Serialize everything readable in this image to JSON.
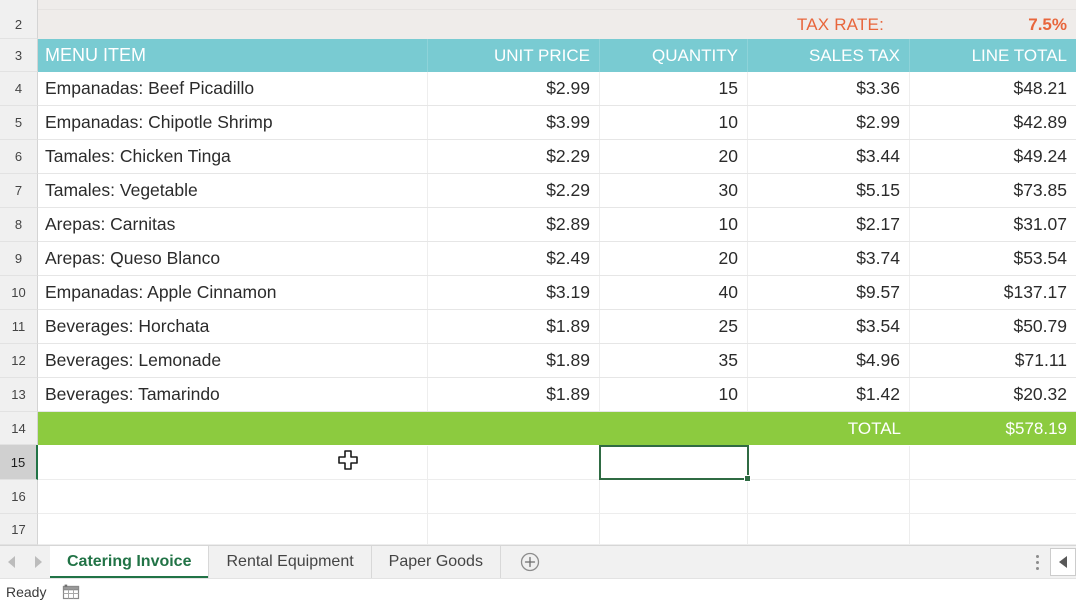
{
  "sheet": {
    "tax_rate_label": "TAX RATE:",
    "tax_rate_value": "7.5%",
    "columns": [
      "MENU ITEM",
      "UNIT PRICE",
      "QUANTITY",
      "SALES TAX",
      "LINE TOTAL"
    ],
    "rows": [
      {
        "num": "4",
        "item": "Empanadas: Beef Picadillo",
        "price": "$2.99",
        "qty": "15",
        "tax": "$3.36",
        "total": "$48.21"
      },
      {
        "num": "5",
        "item": "Empanadas: Chipotle Shrimp",
        "price": "$3.99",
        "qty": "10",
        "tax": "$2.99",
        "total": "$42.89"
      },
      {
        "num": "6",
        "item": "Tamales: Chicken Tinga",
        "price": "$2.29",
        "qty": "20",
        "tax": "$3.44",
        "total": "$49.24"
      },
      {
        "num": "7",
        "item": "Tamales: Vegetable",
        "price": "$2.29",
        "qty": "30",
        "tax": "$5.15",
        "total": "$73.85"
      },
      {
        "num": "8",
        "item": "Arepas: Carnitas",
        "price": "$2.89",
        "qty": "10",
        "tax": "$2.17",
        "total": "$31.07"
      },
      {
        "num": "9",
        "item": "Arepas: Queso Blanco",
        "price": "$2.49",
        "qty": "20",
        "tax": "$3.74",
        "total": "$53.54"
      },
      {
        "num": "10",
        "item": "Empanadas: Apple Cinnamon",
        "price": "$3.19",
        "qty": "40",
        "tax": "$9.57",
        "total": "$137.17"
      },
      {
        "num": "11",
        "item": "Beverages: Horchata",
        "price": "$1.89",
        "qty": "25",
        "tax": "$3.54",
        "total": "$50.79"
      },
      {
        "num": "12",
        "item": "Beverages: Lemonade",
        "price": "$1.89",
        "qty": "35",
        "tax": "$4.96",
        "total": "$71.11"
      },
      {
        "num": "13",
        "item": "Beverages: Tamarindo",
        "price": "$1.89",
        "qty": "10",
        "tax": "$1.42",
        "total": "$20.32"
      }
    ],
    "total_row": {
      "num": "14",
      "label": "TOTAL",
      "value": "$578.19"
    },
    "empty_rows": [
      {
        "num": "15"
      },
      {
        "num": "16"
      },
      {
        "num": "17"
      }
    ],
    "header_row_num": "3",
    "taxrate_row_num": "2"
  },
  "tabs": {
    "items": [
      {
        "label": "Catering Invoice",
        "active": true
      },
      {
        "label": "Rental Equipment",
        "active": false
      },
      {
        "label": "Paper Goods",
        "active": false
      }
    ],
    "add_sheet_icon": "plus-circle-icon",
    "prev_icon": "previous-sheet-icon",
    "next_icon": "next-sheet-icon"
  },
  "statusbar": {
    "status": "Ready",
    "grid_icon": "sheet-view-icon"
  },
  "colors": {
    "header_teal": "#79cbd2",
    "total_green": "#8ccb3f",
    "accent_orange": "#e8663c",
    "tab_green": "#217346",
    "selection_green": "#2f6b43",
    "taxrate_band": "#efecea"
  }
}
